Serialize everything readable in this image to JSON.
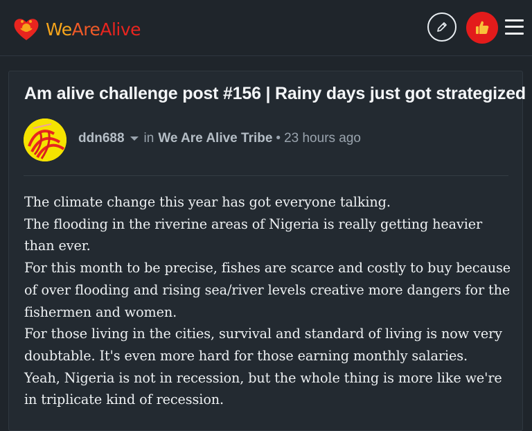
{
  "header": {
    "brand": {
      "part1": "We",
      "part2": "Are",
      "part3": "Alive"
    },
    "edit_icon": "pencil-icon",
    "user_icon": "thumbs-up-icon",
    "menu_icon": "hamburger-menu-icon",
    "colors": {
      "brand_red": "#e8251f",
      "brand_orange": "#f05a28",
      "brand_yellow": "#f7a51b",
      "background": "#1f252b"
    }
  },
  "post": {
    "title": "Am alive challenge post #156 | Rainy days just got strategized",
    "title_sup": "°",
    "author": "ddn688",
    "in_label": "in",
    "community": "We Are Alive Tribe",
    "separator": "•",
    "time_ago": "23 hours ago",
    "body": [
      "The climate change this year has got everyone talking.",
      "The flooding in the riverine areas of Nigeria is really getting heavier than ever.",
      "For this month to be precise, fishes are scarce and costly to buy because of over flooding and rising sea/river levels creative more dangers for the fishermen and women.",
      "For those living in the cities, survival and standard of living is now very doubtable. It's even more hard for those earning monthly salaries.",
      "Yeah, Nigeria is not in recession, but the whole thing is more like we're in triplicate kind of recession."
    ]
  }
}
